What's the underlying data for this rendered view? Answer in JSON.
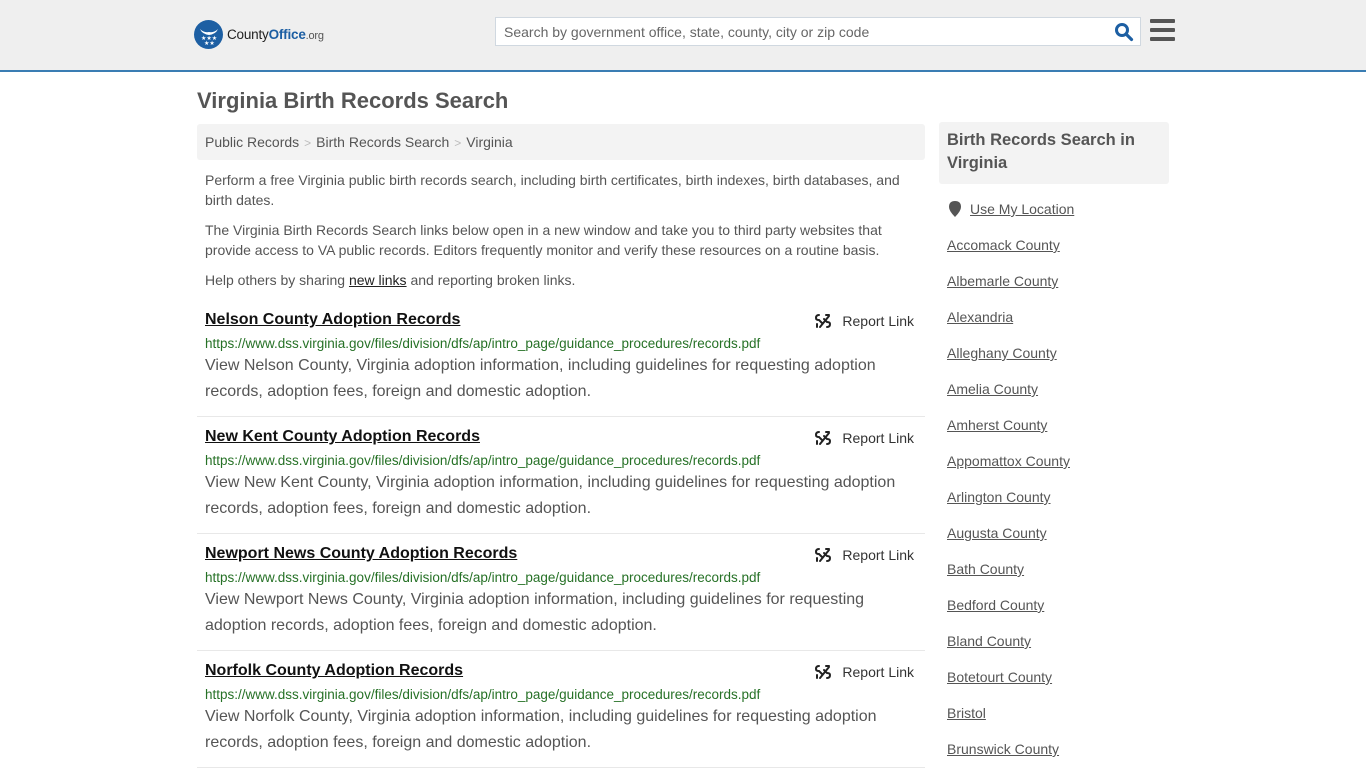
{
  "header": {
    "logo": {
      "county": "County",
      "office": "Office",
      "org": ".org"
    },
    "search_placeholder": "Search by government office, state, county, city or zip code",
    "search_icon": "search-icon",
    "menu_icon": "hamburger-menu-icon"
  },
  "page_title": "Virginia Birth Records Search",
  "breadcrumb": [
    {
      "label": "Public Records"
    },
    {
      "label": "Birth Records Search"
    },
    {
      "label": "Virginia"
    }
  ],
  "intro": {
    "p1": "Perform a free Virginia public birth records search, including birth certificates, birth indexes, birth databases, and birth dates.",
    "p2": "The Virginia Birth Records Search links below open in a new window and take you to third party websites that provide access to VA public records. Editors frequently monitor and verify these resources on a routine basis.",
    "p3_before": "Help others by sharing ",
    "p3_link": "new links",
    "p3_after": " and reporting broken links."
  },
  "report_label": "Report Link",
  "results": [
    {
      "title": "Nelson County Adoption Records",
      "url": "https://www.dss.virginia.gov/files/division/dfs/ap/intro_page/guidance_procedures/records.pdf",
      "description": "View Nelson County, Virginia adoption information, including guidelines for requesting adoption records, adoption fees, foreign and domestic adoption."
    },
    {
      "title": "New Kent County Adoption Records",
      "url": "https://www.dss.virginia.gov/files/division/dfs/ap/intro_page/guidance_procedures/records.pdf",
      "description": "View New Kent County, Virginia adoption information, including guidelines for requesting adoption records, adoption fees, foreign and domestic adoption."
    },
    {
      "title": "Newport News County Adoption Records",
      "url": "https://www.dss.virginia.gov/files/division/dfs/ap/intro_page/guidance_procedures/records.pdf",
      "description": "View Newport News County, Virginia adoption information, including guidelines for requesting adoption records, adoption fees, foreign and domestic adoption."
    },
    {
      "title": "Norfolk County Adoption Records",
      "url": "https://www.dss.virginia.gov/files/division/dfs/ap/intro_page/guidance_procedures/records.pdf",
      "description": "View Norfolk County, Virginia adoption information, including guidelines for requesting adoption records, adoption fees, foreign and domestic adoption."
    }
  ],
  "sidebar": {
    "heading": "Birth Records Search in Virginia",
    "use_location": "Use My Location",
    "locations": [
      "Accomack County",
      "Albemarle County",
      "Alexandria",
      "Alleghany County",
      "Amelia County",
      "Amherst County",
      "Appomattox County",
      "Arlington County",
      "Augusta County",
      "Bath County",
      "Bedford County",
      "Bland County",
      "Botetourt County",
      "Bristol",
      "Brunswick County"
    ]
  },
  "colors": {
    "brand_blue": "#1d5fa3",
    "header_border": "#3a7db3",
    "url_green": "#267126"
  }
}
